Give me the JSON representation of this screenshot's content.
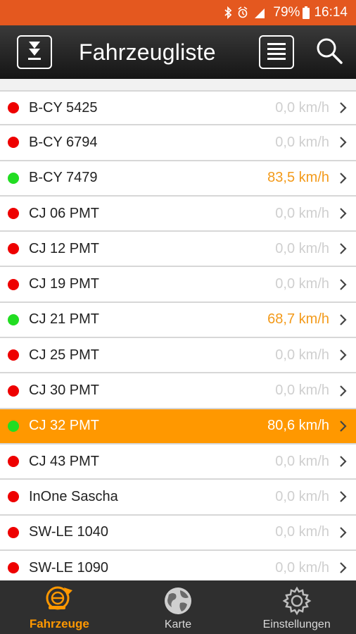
{
  "status_bar": {
    "battery": "79%",
    "time": "16:14",
    "color": "#e4581f"
  },
  "app_bar": {
    "title": "Fahrzeugliste"
  },
  "vehicles": [
    {
      "name": "B-CY 5425",
      "speed": "0,0 km/h",
      "status": "stopped"
    },
    {
      "name": "B-CY 6794",
      "speed": "0,0 km/h",
      "status": "stopped"
    },
    {
      "name": "B-CY 7479",
      "speed": "83,5 km/h",
      "status": "moving"
    },
    {
      "name": "CJ 06 PMT",
      "speed": "0,0 km/h",
      "status": "stopped"
    },
    {
      "name": "CJ 12 PMT",
      "speed": "0,0 km/h",
      "status": "stopped"
    },
    {
      "name": "CJ 19 PMT",
      "speed": "0,0 km/h",
      "status": "stopped"
    },
    {
      "name": "CJ 21 PMT",
      "speed": "68,7 km/h",
      "status": "moving"
    },
    {
      "name": "CJ 25 PMT",
      "speed": "0,0 km/h",
      "status": "stopped"
    },
    {
      "name": "CJ 30 PMT",
      "speed": "0,0 km/h",
      "status": "stopped"
    },
    {
      "name": "CJ 32 PMT",
      "speed": "80,6 km/h",
      "status": "moving",
      "selected": true
    },
    {
      "name": "CJ 43 PMT",
      "speed": "0,0 km/h",
      "status": "stopped"
    },
    {
      "name": "InOne Sascha",
      "speed": "0,0 km/h",
      "status": "stopped"
    },
    {
      "name": "SW-LE 1040",
      "speed": "0,0 km/h",
      "status": "stopped"
    },
    {
      "name": "SW-LE 1090",
      "speed": "0,0 km/h",
      "status": "stopped"
    }
  ],
  "colors": {
    "accent": "#ff9800",
    "moving_dot": "#22dd22",
    "stopped_dot": "#ee0000"
  },
  "bottom_nav": {
    "items": [
      {
        "label": "Fahrzeuge",
        "icon": "vehicles-icon",
        "active": true
      },
      {
        "label": "Karte",
        "icon": "globe-icon",
        "active": false
      },
      {
        "label": "Einstellungen",
        "icon": "gear-icon",
        "active": false
      }
    ]
  }
}
